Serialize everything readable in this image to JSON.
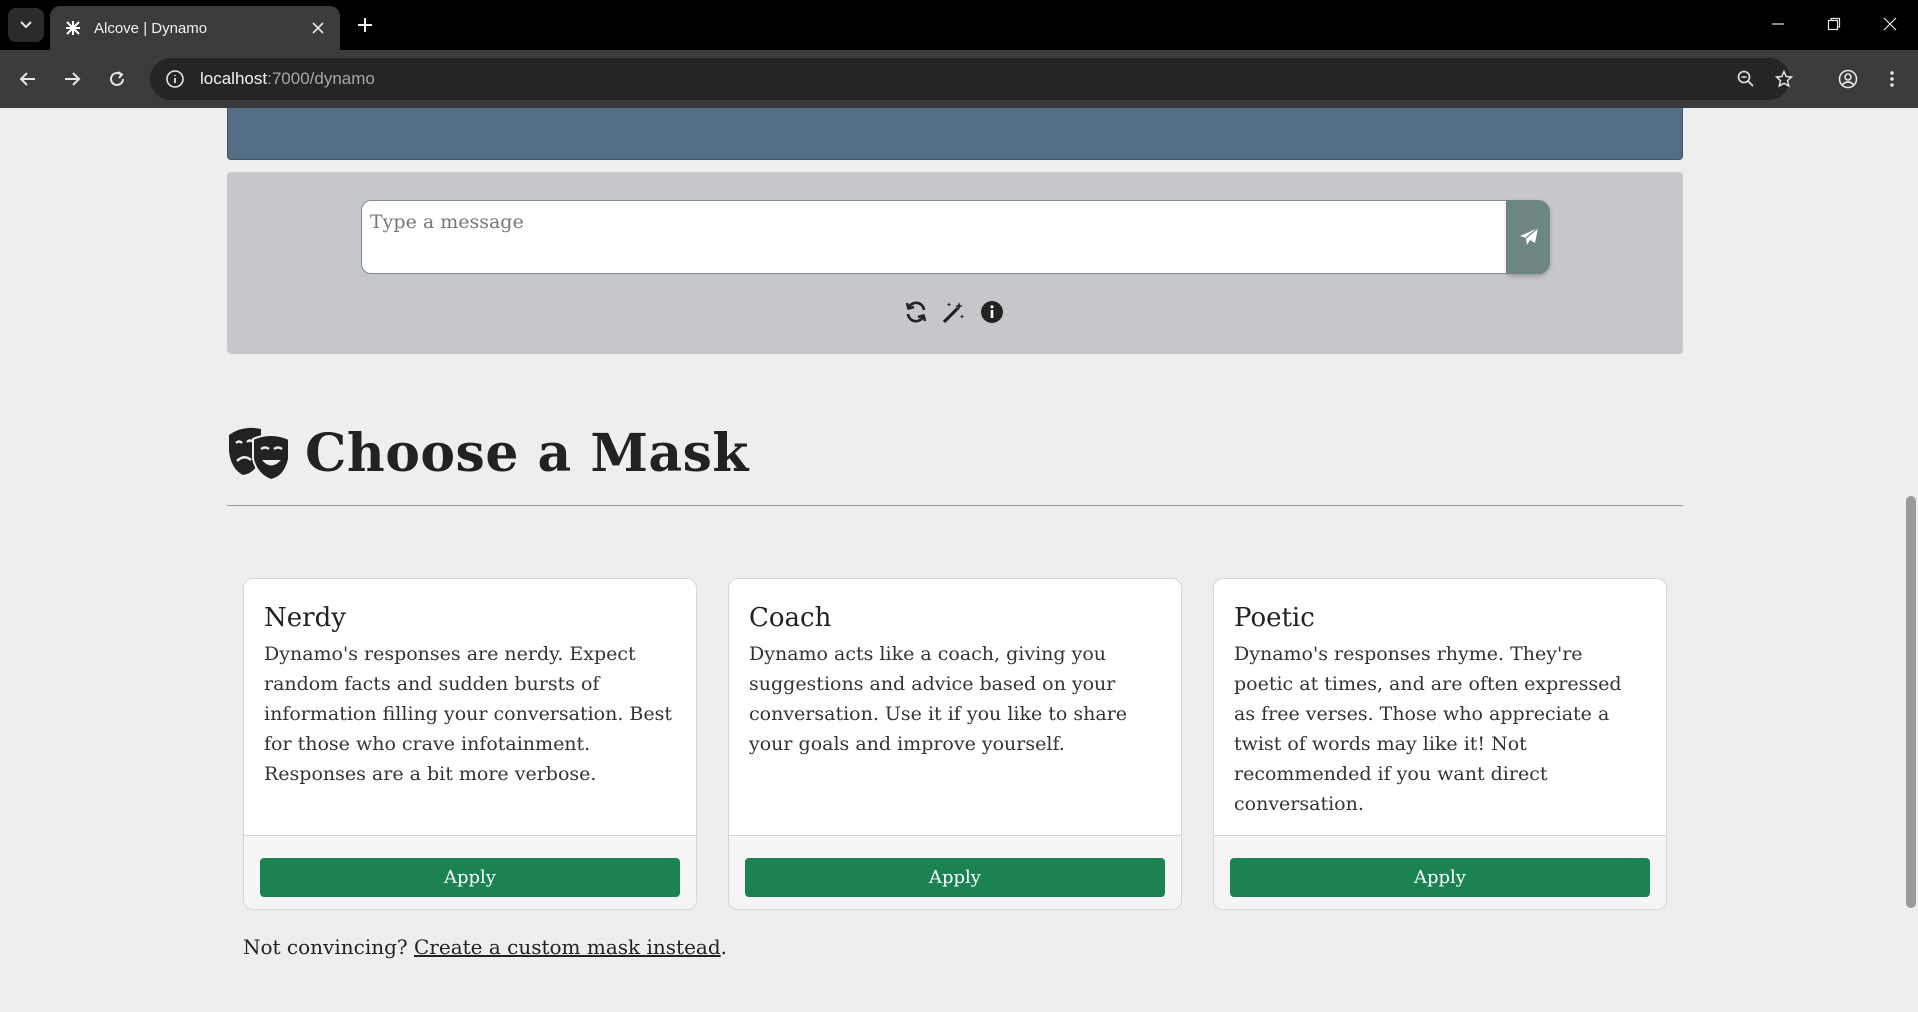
{
  "browser": {
    "tab_title": "Alcove | Dynamo",
    "url_host": "localhost",
    "url_path": ":7000/dynamo"
  },
  "chat": {
    "input_placeholder": "Type a message",
    "actions": [
      "refresh-icon",
      "magic-wand-icon",
      "info-icon"
    ]
  },
  "masks": {
    "heading": "Choose a Mask",
    "cards": [
      {
        "title": "Nerdy",
        "description": "Dynamo's responses are nerdy. Expect random facts and sudden bursts of information filling your conversation. Best for those who crave infotainment. Responses are a bit more verbose.",
        "button": "Apply"
      },
      {
        "title": "Coach",
        "description": "Dynamo acts like a coach, giving you suggestions and advice based on your conversation. Use it if you like to share your goals and improve yourself.",
        "button": "Apply"
      },
      {
        "title": "Poetic",
        "description": "Dynamo's responses rhyme. They're poetic at times, and are often expressed as free verses. Those who appreciate a twist of words may like it! Not recommended if you want direct conversation.",
        "button": "Apply"
      }
    ],
    "footnote_prefix": "Not convincing? ",
    "footnote_link": "Create a custom mask instead",
    "footnote_suffix": "."
  },
  "colors": {
    "chat_top": "#536d84",
    "input_panel": "#c6c7ca",
    "send_button": "#6d8583",
    "apply_button": "#1b8352"
  }
}
